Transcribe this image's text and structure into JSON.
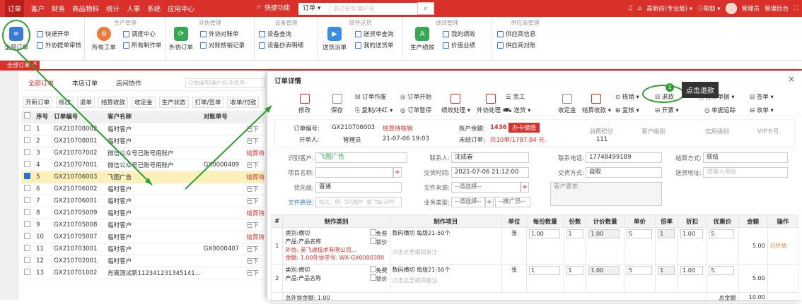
{
  "topbar": {
    "menu": [
      "订单",
      "客户",
      "财务",
      "商品物料",
      "统计",
      "人事",
      "系统",
      "应用中心"
    ],
    "quick": "快捷功能",
    "search_type": "订单",
    "search_placeholder": "选订单号/客户名",
    "store": "高新店(专业版)",
    "help": "帮助",
    "admin": "管理员",
    "backend": "管理后台"
  },
  "ribbon": {
    "groups": [
      "生产管理",
      "外协管理",
      "设备管理",
      "取件送货",
      "绩效管理",
      "供应商管理"
    ],
    "all_orders": "全部订单",
    "quick_order": "快速开单",
    "outsource_review": "外协提单审核",
    "all_work": "所有工单",
    "dispatch": "调度中心",
    "all_production": "所有制作单",
    "outsource_orders": "外协订单",
    "outsource_recon": "外协对账单",
    "recon_records": "对账核销记录",
    "equip_query": "设备查询",
    "equip_copy": "设备抄表明细",
    "delivery_dispatch": "送货派单",
    "delivery_query": "送货单查询",
    "my_delivery": "我的送货单",
    "prod_perf": "生产绩效",
    "my_perf": "我的绩效",
    "price_perf": "价值业绩",
    "supplier_info": "供应商信息",
    "supplier_recon": "供应商对账"
  },
  "tab": {
    "label": "全部订单"
  },
  "list": {
    "tabs": [
      "全部订单",
      "本店订单",
      "店间协作"
    ],
    "search_placeholder": "订单编号/客户名/手机号",
    "toolbar": [
      "开新订单",
      "修改",
      "退单",
      "结算收款",
      "收定金",
      "生产状态",
      "打单/签单",
      "收单/付款"
    ],
    "headers": [
      "序号",
      "订单编号",
      "客户名称",
      "对账单号"
    ],
    "rows": [
      {
        "no": "1",
        "id": "GX210708002",
        "name": "临时客户",
        "recon": "",
        "status": "已下"
      },
      {
        "no": "2",
        "id": "GX210708001",
        "name": "临时客户",
        "recon": "",
        "status": "已下"
      },
      {
        "no": "3",
        "id": "GX210707002",
        "name": "微信公众号已账号用账户",
        "recon": "",
        "status": "结算待"
      },
      {
        "no": "4",
        "id": "GX210707001",
        "name": "微信公众号已账号用账户",
        "recon": "GX0000409",
        "status": "已下"
      },
      {
        "no": "5",
        "id": "GX210706003",
        "name": "飞图广告",
        "recon": "",
        "status": "结算待"
      },
      {
        "no": "6",
        "id": "GX210706002",
        "name": "临时客户",
        "recon": "",
        "status": "已下"
      },
      {
        "no": "7",
        "id": "GX210706001",
        "name": "临时客户",
        "recon": "",
        "status": "已下"
      },
      {
        "no": "8",
        "id": "GX210705009",
        "name": "临时客户",
        "recon": "",
        "status": "结算待"
      },
      {
        "no": "9",
        "id": "GX210705008",
        "name": "临时客户",
        "recon": "",
        "status": "已下"
      },
      {
        "no": "10",
        "id": "GX210705007",
        "name": "临时客户",
        "recon": "",
        "status": "结算待"
      },
      {
        "no": "11",
        "id": "GX210703001",
        "name": "临时客户",
        "recon": "GX0000407",
        "status": "已下"
      },
      {
        "no": "12",
        "id": "GX210702001",
        "name": "临时客户",
        "recon": "",
        "status": "已下"
      },
      {
        "no": "13",
        "id": "GX210701002",
        "name": "肖离测试新112341231345141...",
        "recon": "",
        "status": "已下"
      }
    ]
  },
  "modal": {
    "title": "订单详情",
    "toolbar": {
      "edit": "修改",
      "save": "保存",
      "order_void": "订单作废",
      "copy_order": "复制/冲红",
      "order_start": "订单开始",
      "order_pause": "订单暂停",
      "perf": "绩效处理",
      "outsource": "外协处理",
      "ship": "送货",
      "finish": "完工",
      "deposit": "收定金",
      "settle": "结算收款",
      "verify": "核销",
      "recheck": "复核",
      "refund": "退款",
      "invoice": "开票",
      "print": "打印单据",
      "sign": "签单",
      "timeline": "单据追踪",
      "receipt": "收单"
    },
    "info": {
      "order_no_label": "订单编号:",
      "order_no": "GX210706003",
      "status": "结算待核销",
      "opener_label": "开单人:",
      "opener": "管理员",
      "date": "21-07-06 19:03",
      "balance_label": "账户余额:",
      "balance": "1436",
      "recharge": "办卡储值",
      "unsettled_label": "未结订单:",
      "unsettled": "共10单/1787.84 元",
      "points_label": "消费积分",
      "points": "111",
      "level_label": "客户级别",
      "credit_label": "信用级别",
      "vip_label": "VIP卡号"
    },
    "form": {
      "customer_label": "识别客户:",
      "customer": "飞图广告",
      "contact_label": "联系人:",
      "contact": "沈成春",
      "phone_label": "联系电话:",
      "phone": "17748499189",
      "pay_label": "结算方式:",
      "pay": "现结",
      "project_label": "项目名称:",
      "time_label": "交货时间:",
      "time": "2021-07-06 21:12:00",
      "delivery_label": "交货方式:",
      "delivery": "自取",
      "address_label": "送货地址:",
      "address_placeholder": "请输入地址",
      "priority_label": "优先级:",
      "priority": "普通",
      "source_label": "文件来源:",
      "source": "--请选择--",
      "remark_label": "客户要求:",
      "path_label": "文件路径:",
      "path_placeholder": "格式。例: 'D:\\图片' 或 'ftp://IP/'",
      "biz_label": "业务类型:",
      "biz": "--请选择--",
      "promoter": "--推广员--"
    },
    "detail": {
      "headers": [
        "#",
        "制作类别",
        "制作项目",
        "单位",
        "每份数量",
        "份数",
        "计价数量",
        "单价",
        "倍率",
        "折扣",
        "优惠价",
        "金额",
        "操作"
      ],
      "r1": {
        "no": "1",
        "cat": "类别:横切",
        "prod": "产品:产品名称",
        "free": "免费",
        "price_flag": "锁价",
        "outsource": "外协: 英飞速技术有限公司...",
        "amount_line": "金额: 1.00外协单号: WX-GX0000380",
        "item": "数码横切 每版21-50个",
        "note": "点击这里编辑备注",
        "unit": "张",
        "per": "1.00",
        "copies": "1",
        "qty": "1.00",
        "price": "5",
        "rate": "1",
        "disc": "1.00",
        "promo": "5",
        "amount": "5.00",
        "op": "已外协"
      },
      "r2": {
        "no": "2",
        "cat": "类别:横切",
        "prod": "产品:产品名称",
        "free": "免费",
        "price_flag": "锁价",
        "item": "数码横切 每版21-50个",
        "note": "点击这里编辑备注",
        "unit": "张",
        "per": "1",
        "copies": "1",
        "qty": "1.00",
        "price": "5",
        "rate": "1",
        "disc": "1.00",
        "promo": "5",
        "amount": "5.00"
      },
      "footer_left": "总外协金额: 1.00",
      "footer_total_label": "总金额",
      "footer_total": "10.00"
    }
  },
  "annotation": {
    "step": "1",
    "tooltip": "点击退款"
  }
}
